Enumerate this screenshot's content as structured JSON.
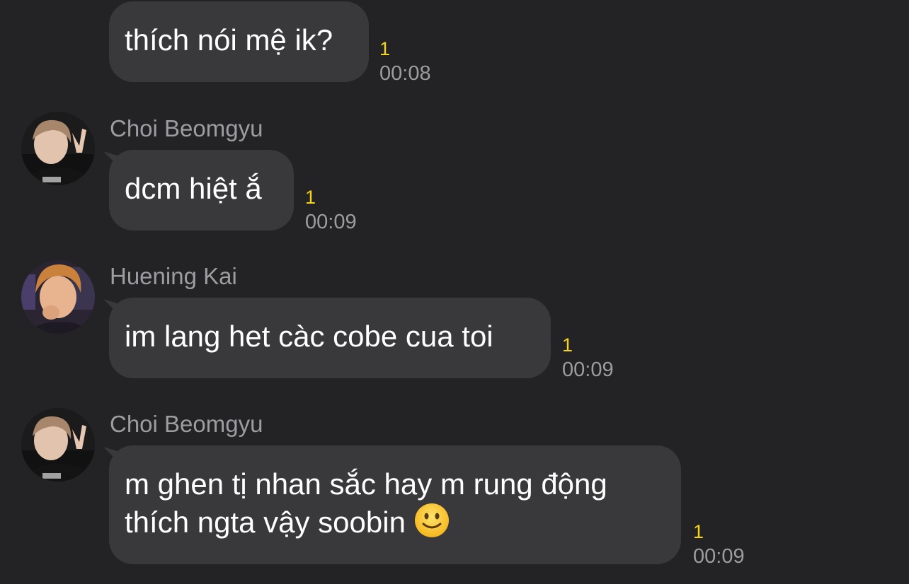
{
  "messages": [
    {
      "sender": "",
      "text_lines": [
        "thích nói mệ ik?"
      ],
      "unread": "1",
      "time": "00:08"
    },
    {
      "sender": "Choi Beomgyu",
      "text_lines": [
        "dcm hiệt ắ"
      ],
      "unread": "1",
      "time": "00:09"
    },
    {
      "sender": "Huening Kai",
      "text_lines": [
        "im lang het càc cobe cua toi"
      ],
      "unread": "1",
      "time": "00:09"
    },
    {
      "sender": "Choi Beomgyu",
      "text_lines": [
        "m ghen tị nhan sắc hay m rung động",
        "thích ngta vậy soobin"
      ],
      "emoji": "slightly-smiling-face",
      "unread": "1",
      "time": "00:09"
    }
  ],
  "colors": {
    "background": "#232325",
    "bubble": "#39393c",
    "unread": "#f7d418",
    "meta_text": "#9d9da1",
    "message_text": "#ffffff"
  }
}
